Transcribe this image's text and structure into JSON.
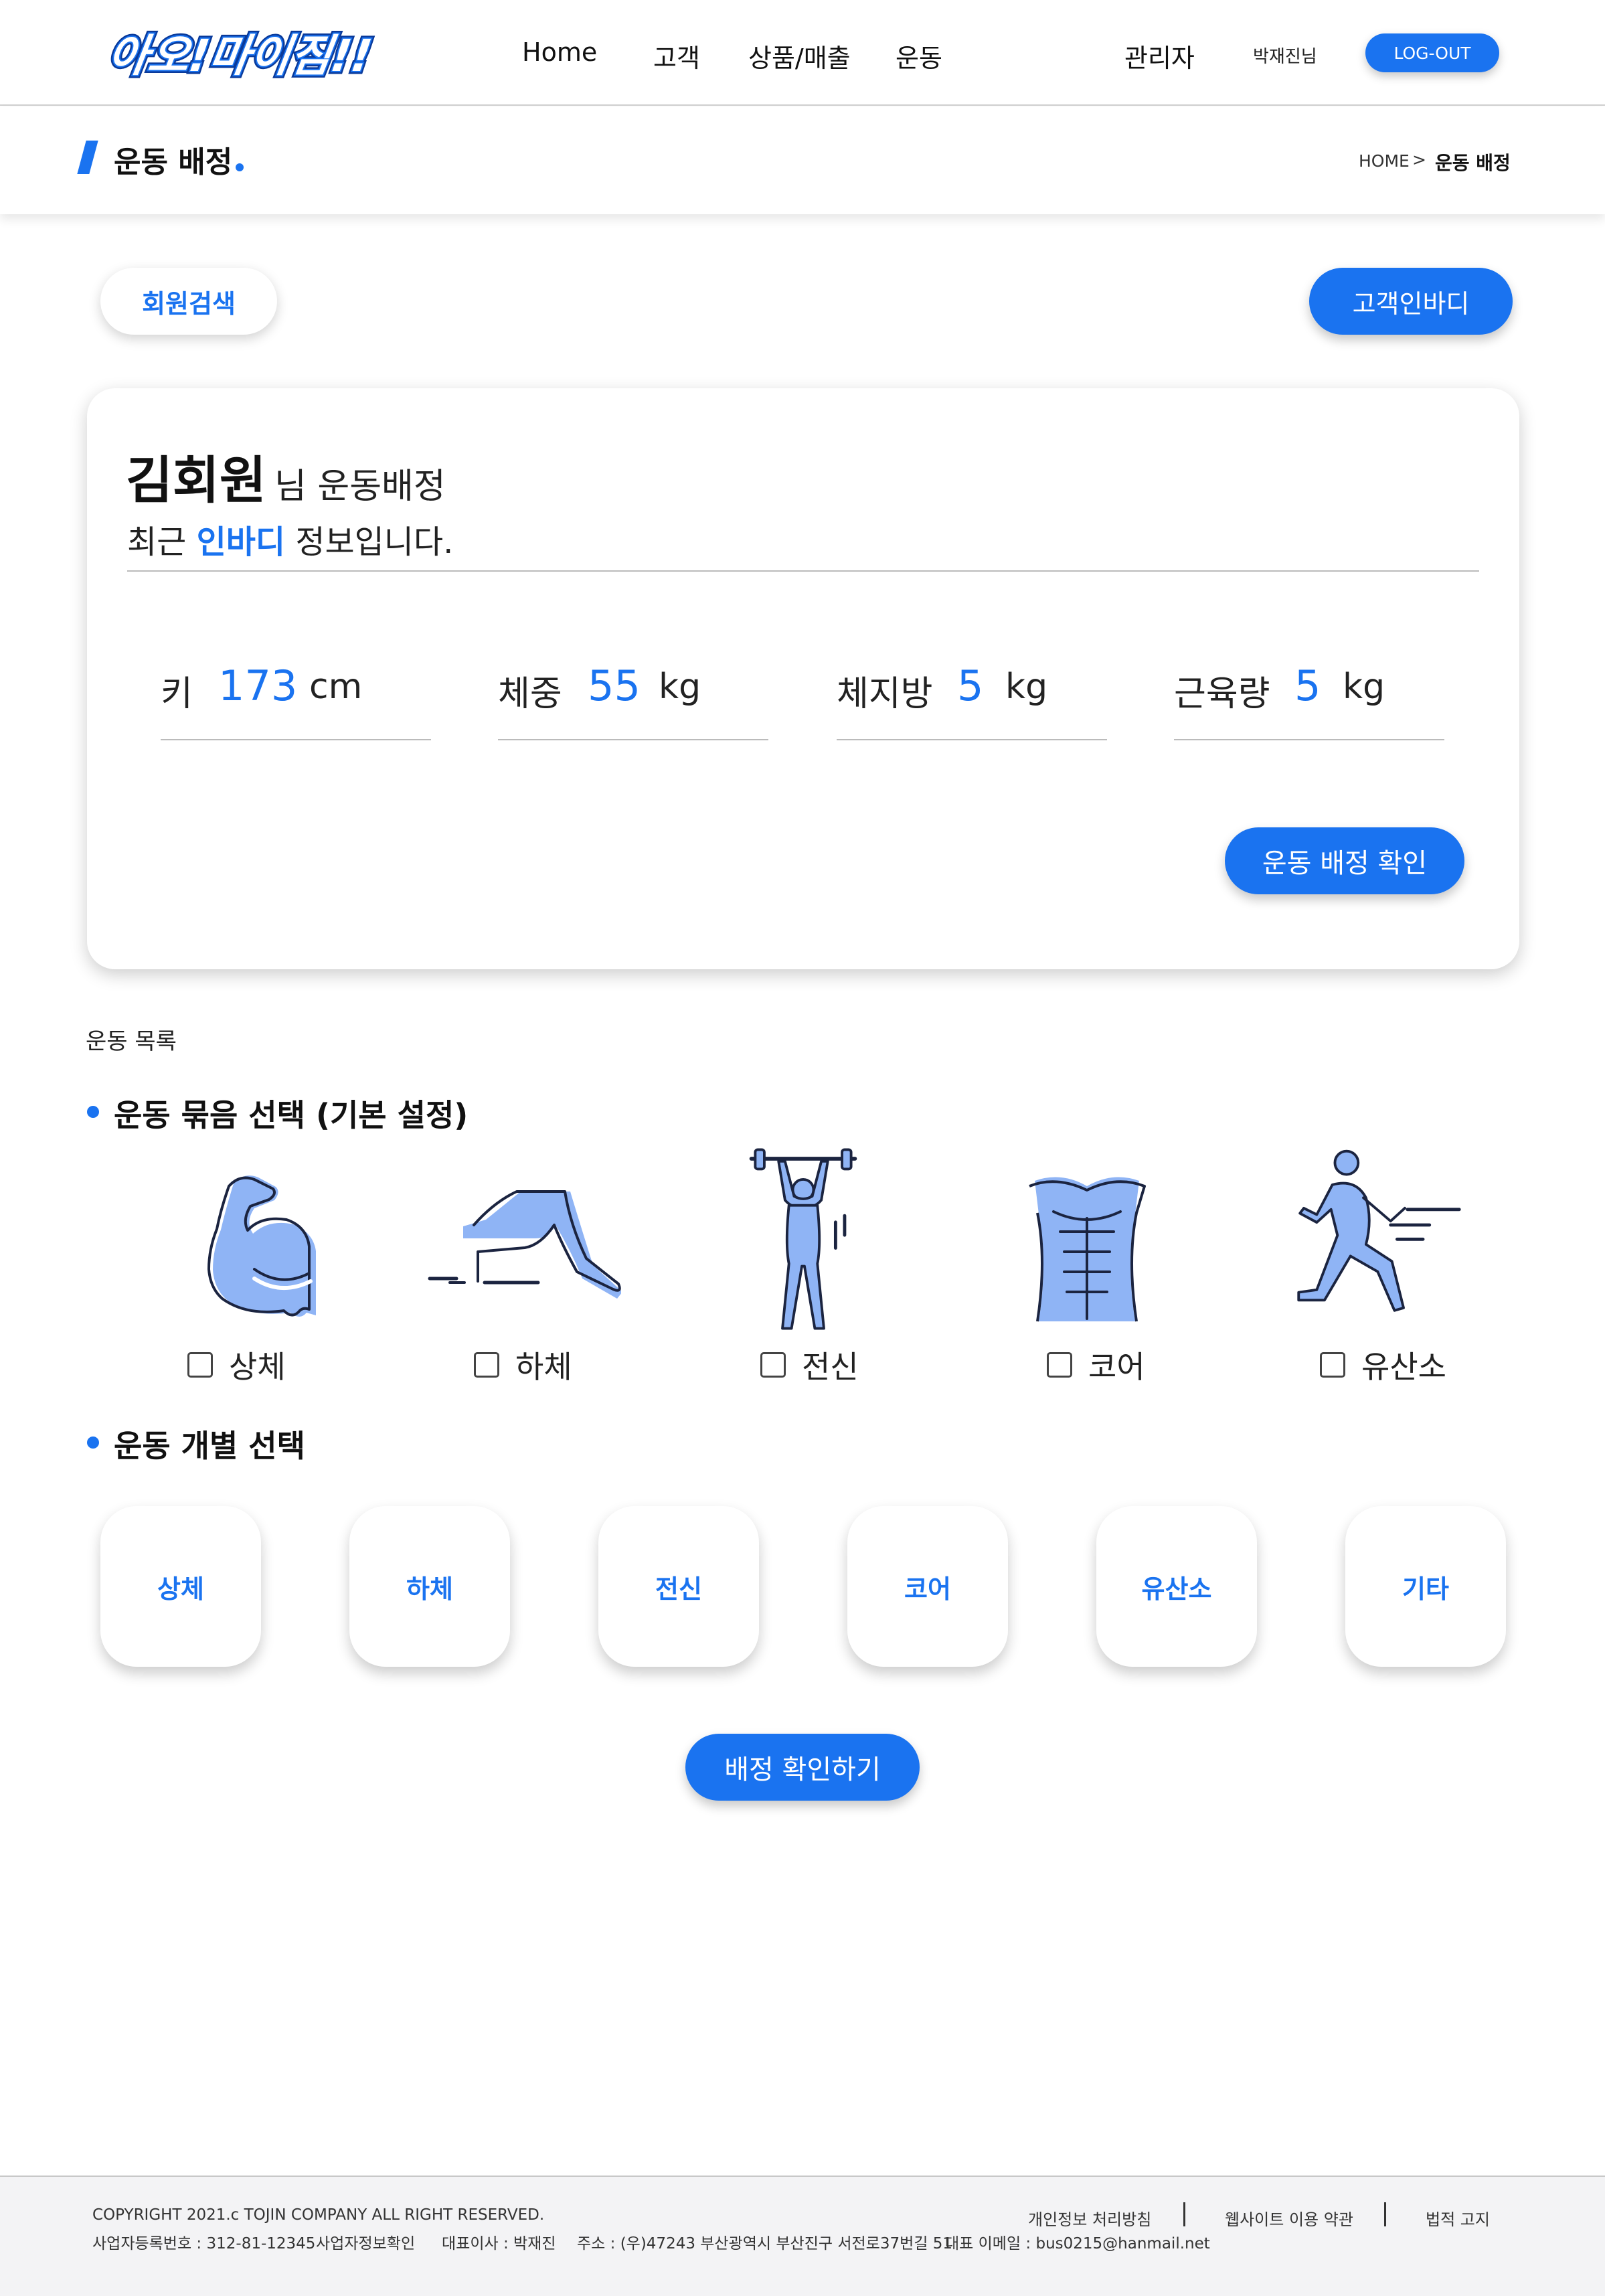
{
  "header": {
    "logo_text": "아오!마이짐!!",
    "nav": [
      "Home",
      "고객",
      "상품/매출",
      "운동"
    ],
    "admin_label": "관리자",
    "user_name": "박재진님",
    "logout_label": "LOG-OUT"
  },
  "subheader": {
    "title": "운동 배정",
    "breadcrumb": {
      "home": "HOME",
      "separator": ">",
      "current": "운동 배정"
    }
  },
  "actions": {
    "member_search_label": "회원검색",
    "customer_inbody_label": "고객인바디"
  },
  "member_card": {
    "name": "김회원",
    "suffix": "님 운동배정",
    "recent_prefix": "최근 ",
    "recent_highlight": "인바디",
    "recent_suffix": " 정보입니다.",
    "stats": [
      {
        "label": "키",
        "value": "173",
        "unit": "cm"
      },
      {
        "label": "체중",
        "value": "55",
        "unit": "kg"
      },
      {
        "label": "체지방",
        "value": "5",
        "unit": "kg"
      },
      {
        "label": "근육량",
        "value": "5",
        "unit": "kg"
      }
    ],
    "confirm_label": "운동 배정 확인"
  },
  "exercise_list": {
    "title": "운동 목록",
    "bundle_title": "운동 묶음 선택 (기본 설정)",
    "bundles": [
      {
        "label": "상체",
        "icon": "arm-muscle-icon",
        "checked": false
      },
      {
        "label": "하체",
        "icon": "lunge-legs-icon",
        "checked": false
      },
      {
        "label": "전신",
        "icon": "weightlifter-icon",
        "checked": false
      },
      {
        "label": "코어",
        "icon": "torso-abs-icon",
        "checked": false
      },
      {
        "label": "유산소",
        "icon": "runner-icon",
        "checked": false
      }
    ],
    "individual_title": "운동 개별 선택",
    "categories": [
      "상체",
      "하체",
      "전신",
      "코어",
      "유산소",
      "기타"
    ],
    "final_confirm_label": "배정 확인하기"
  },
  "footer": {
    "copyright": "COPYRIGHT 2021.c TOJIN COMPANY ALL RIGHT RESERVED.",
    "biz_number": "사업자등록번호 : 312-81-12345",
    "biz_check": "사업자정보확인",
    "ceo": "대표이사 : 박재진",
    "address": "주소 : (우)47243 부산광역시 부산진구 서전로37번길 51",
    "email": "대표 이메일 : bus0215@hanmail.net",
    "links": [
      "개인정보 처리방침",
      "웹사이트 이용 약관",
      "법적 고지"
    ]
  },
  "colors": {
    "accent": "#1a73f0",
    "icon_fill": "#8fb4f5",
    "footer_bg": "#f3f3f5"
  }
}
